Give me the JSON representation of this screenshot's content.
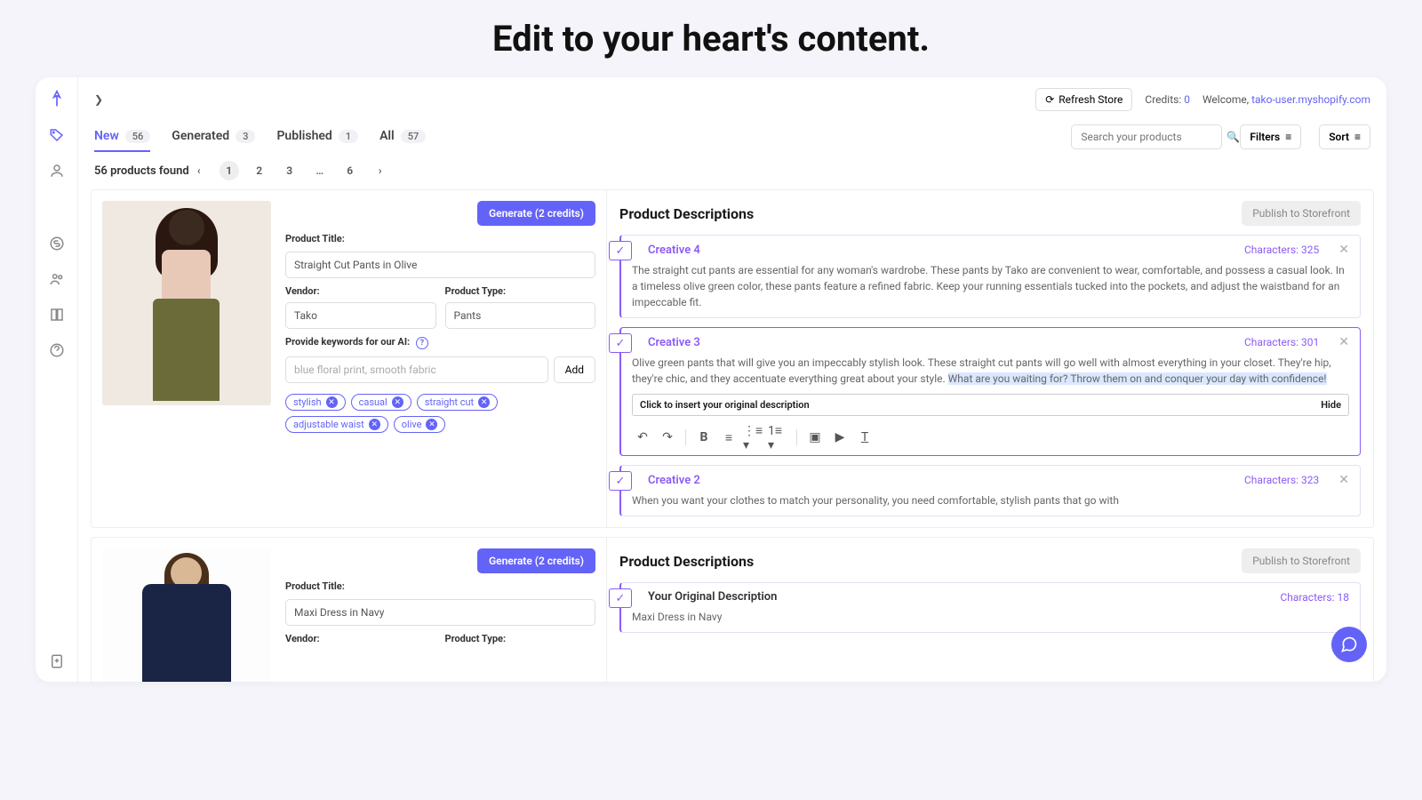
{
  "page_heading": "Edit to your heart's content.",
  "topbar": {
    "refresh_label": "Refresh Store",
    "credits_label": "Credits:",
    "credits_value": "0",
    "welcome_label": "Welcome,",
    "store_link": "tako-user.myshopify.com"
  },
  "tabs": [
    {
      "label": "New",
      "count": "56",
      "active": true
    },
    {
      "label": "Generated",
      "count": "3",
      "active": false
    },
    {
      "label": "Published",
      "count": "1",
      "active": false
    },
    {
      "label": "All",
      "count": "57",
      "active": false
    }
  ],
  "search_placeholder": "Search your products",
  "filters_label": "Filters",
  "sort_label": "Sort",
  "products_found": "56 products found",
  "pagination": {
    "pages": [
      "1",
      "2",
      "3",
      "…",
      "6"
    ],
    "active": "1"
  },
  "labels": {
    "generate_btn": "Generate (2 credits)",
    "product_title": "Product Title:",
    "vendor": "Vendor:",
    "product_type": "Product Type:",
    "keywords": "Provide keywords for our AI:",
    "keywords_placeholder": "blue floral print, smooth fabric",
    "add": "Add",
    "descriptions_heading": "Product Descriptions",
    "publish_btn": "Publish to Storefront",
    "characters_prefix": "Characters:",
    "insert_original": "Click to insert your original description",
    "hide": "Hide"
  },
  "products": [
    {
      "title_value": "Straight Cut Pants in Olive",
      "vendor_value": "Tako",
      "type_value": "Pants",
      "tags": [
        "stylish",
        "casual",
        "straight cut",
        "adjustable waist",
        "olive"
      ],
      "creatives": [
        {
          "name": "Creative 4",
          "chars": "325",
          "text": "The straight cut pants are essential for any woman's wardrobe. These pants by Tako are convenient to wear, comfortable, and possess a casual look. In a timeless olive green color, these pants feature a refined fabric. Keep your running essentials tucked into the pockets, and adjust the waistband for an impeccable fit.",
          "active": false
        },
        {
          "name": "Creative 3",
          "chars": "301",
          "text_a": "Olive green pants that will give you an impeccably stylish look. These straight cut pants will go well with almost everything in your closet. They're hip, they're chic, and they accentuate everything great about your style. ",
          "text_hl": "What are you waiting for? Throw them on and conquer your day with confidence!",
          "active": true,
          "editor": true
        },
        {
          "name": "Creative 2",
          "chars": "323",
          "text": "When you want your clothes to match your personality, you need comfortable, stylish pants that go with",
          "active": false
        }
      ]
    },
    {
      "title_value": "Maxi Dress in Navy",
      "vendor_value": "",
      "type_value": "",
      "creatives": [
        {
          "name": "Your Original Description",
          "chars": "18",
          "text": "Maxi Dress in Navy",
          "plain": true
        }
      ]
    }
  ]
}
